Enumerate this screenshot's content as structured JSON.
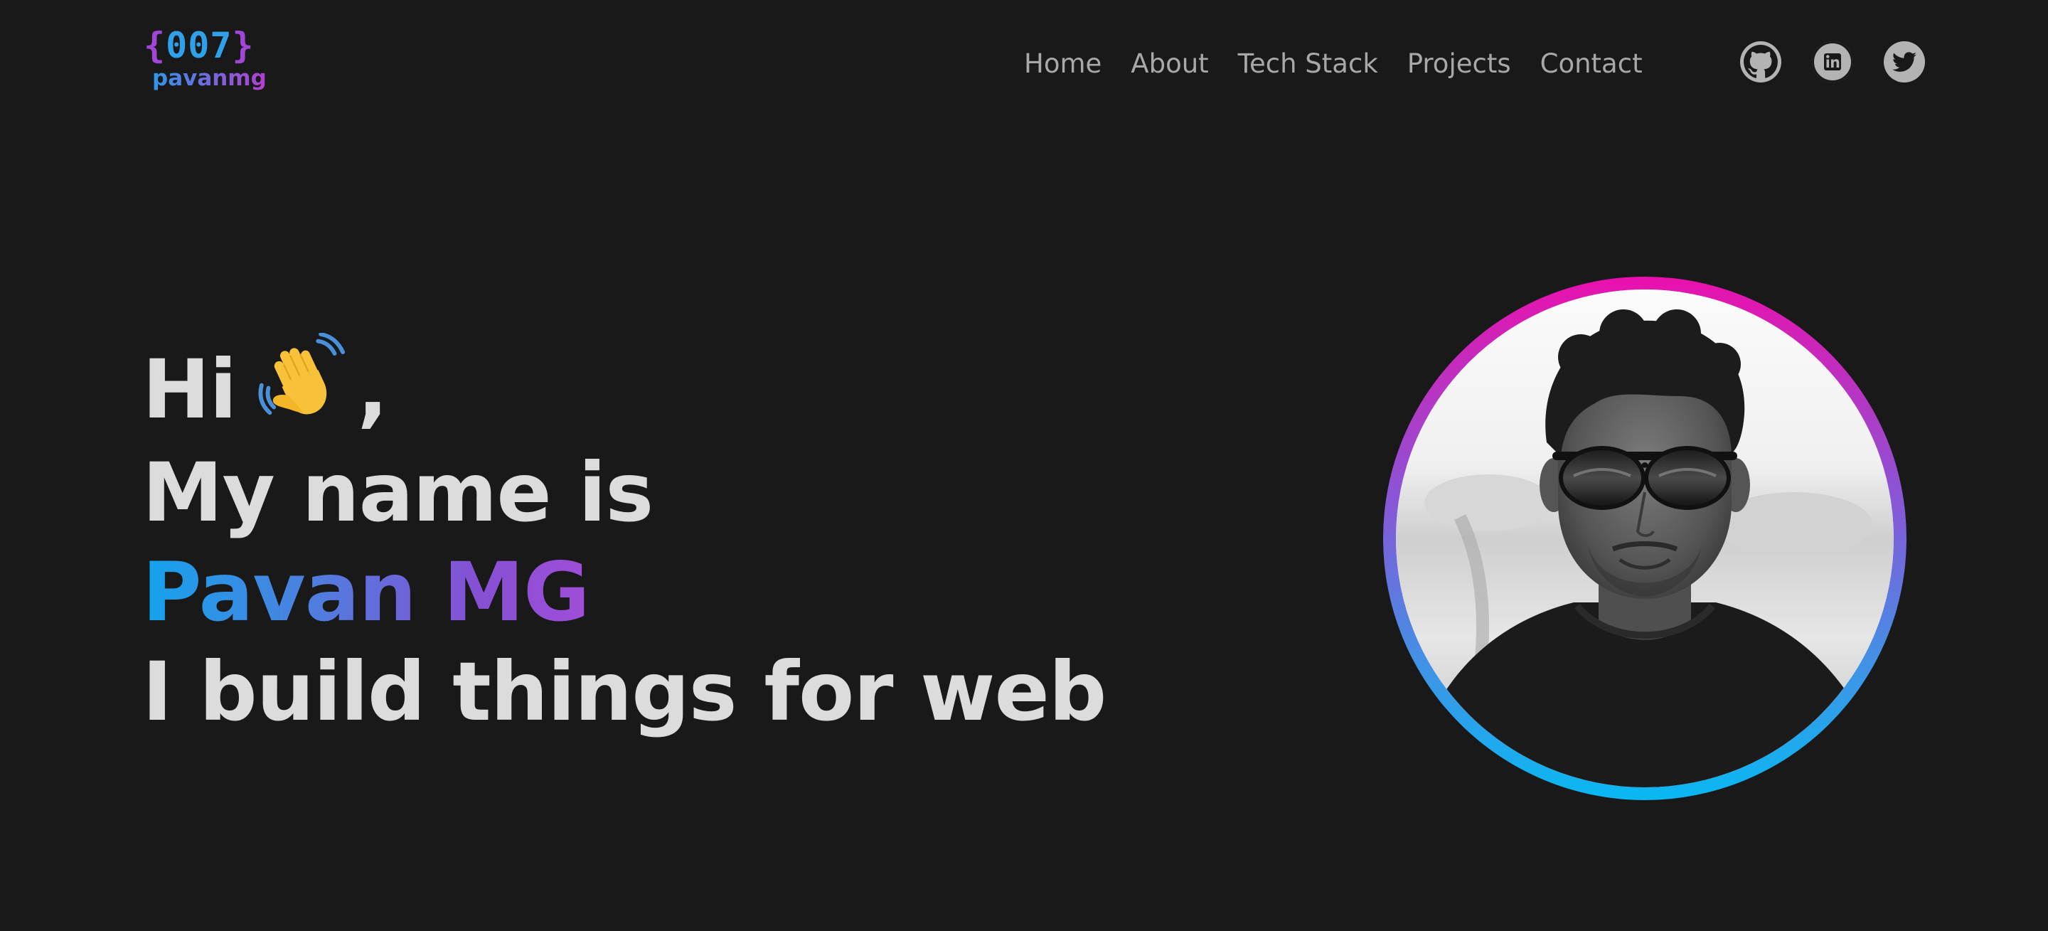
{
  "header": {
    "logo": {
      "brace_open": "{",
      "code": "007",
      "brace_close": "}",
      "name": "pavanmg"
    },
    "nav": [
      {
        "label": "Home"
      },
      {
        "label": "About"
      },
      {
        "label": "Tech Stack"
      },
      {
        "label": "Projects"
      },
      {
        "label": "Contact"
      }
    ],
    "social": [
      {
        "icon": "github-icon"
      },
      {
        "icon": "linkedin-icon"
      },
      {
        "icon": "twitter-icon"
      }
    ]
  },
  "hero": {
    "greeting": "Hi",
    "greeting_suffix": ",",
    "greeting_icon": "waving-hand-icon",
    "intro": "My name is",
    "name": "Pavan MG",
    "tagline": "I build things for web"
  },
  "profile": {
    "icon": "profile-photo"
  },
  "colors": {
    "background": "#191919",
    "text": "#dcdcdc",
    "nav_text": "#a8a8a8",
    "accent_blue": "#14a3ec",
    "accent_purple": "#a04ed8",
    "accent_pink": "#ea10ad"
  }
}
